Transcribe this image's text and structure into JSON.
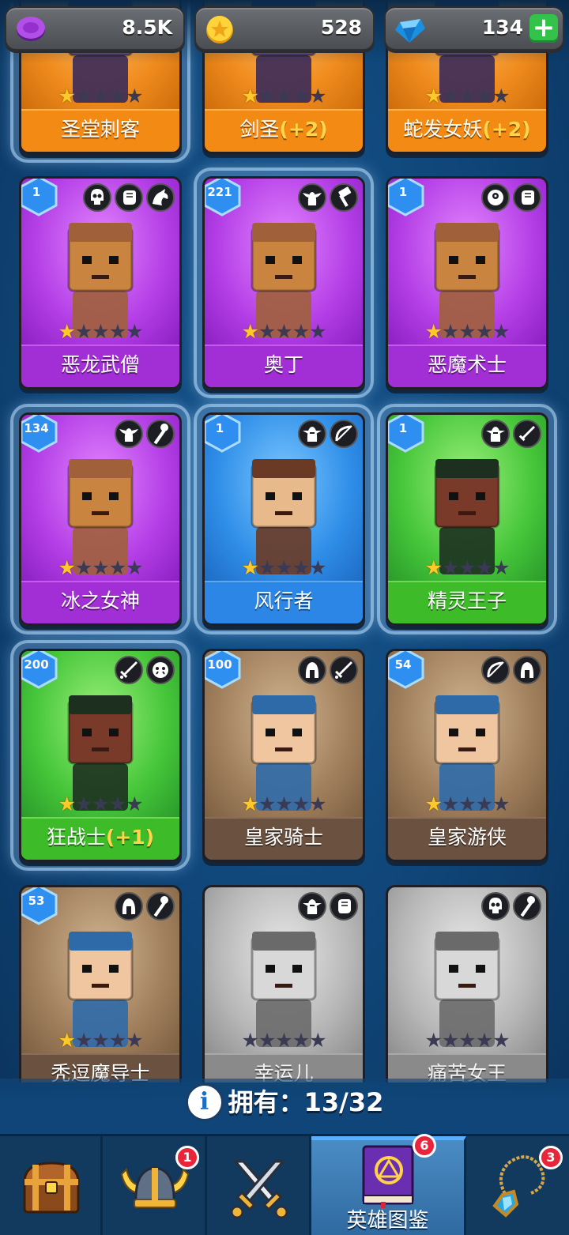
{
  "currency": {
    "gems_purple": "8.5K",
    "coins": "528",
    "diamonds": "134",
    "add_label": "+"
  },
  "cards": [
    {
      "name": "圣堂刺客",
      "bonus": "",
      "stars": 1,
      "max_stars": 5,
      "level": "",
      "rarity": "orange",
      "roles": [],
      "glow": true
    },
    {
      "name": "剑圣",
      "bonus": "(+2)",
      "stars": 1,
      "max_stars": 5,
      "level": "",
      "rarity": "orange",
      "roles": [],
      "glow": false
    },
    {
      "name": "蛇发女妖",
      "bonus": "(+2)",
      "stars": 1,
      "max_stars": 5,
      "level": "",
      "rarity": "orange",
      "roles": [],
      "glow": false
    },
    {
      "name": "恶龙武僧",
      "bonus": "",
      "stars": 1,
      "max_stars": 5,
      "level": "1",
      "rarity": "purple",
      "roles": [
        "skull-icon",
        "fist-icon",
        "dragon-icon"
      ],
      "glow": false
    },
    {
      "name": "奥丁",
      "bonus": "",
      "stars": 1,
      "max_stars": 5,
      "level": "221",
      "rarity": "purple",
      "roles": [
        "winged-helm-icon",
        "hammer-icon"
      ],
      "glow": true
    },
    {
      "name": "恶魔术士",
      "bonus": "",
      "stars": 1,
      "max_stars": 5,
      "level": "1",
      "rarity": "purple",
      "roles": [
        "cyclops-icon",
        "fist-icon"
      ],
      "glow": false
    },
    {
      "name": "冰之女神",
      "bonus": "",
      "stars": 1,
      "max_stars": 5,
      "level": "134",
      "rarity": "purple",
      "roles": [
        "winged-helm-icon",
        "staff-icon"
      ],
      "glow": true
    },
    {
      "name": "风行者",
      "bonus": "",
      "stars": 1,
      "max_stars": 5,
      "level": "1",
      "rarity": "blue",
      "roles": [
        "elf-icon",
        "bow-icon"
      ],
      "glow": true
    },
    {
      "name": "精灵王子",
      "bonus": "",
      "stars": 1,
      "max_stars": 5,
      "level": "1",
      "rarity": "green",
      "roles": [
        "elf-icon",
        "dagger-icon"
      ],
      "glow": true
    },
    {
      "name": "狂战士",
      "bonus": "(+1)",
      "stars": 1,
      "max_stars": 5,
      "level": "200",
      "rarity": "green",
      "roles": [
        "sword-icon",
        "orc-icon"
      ],
      "glow": true
    },
    {
      "name": "皇家骑士",
      "bonus": "",
      "stars": 1,
      "max_stars": 5,
      "level": "100",
      "rarity": "brown",
      "roles": [
        "helmet-icon",
        "sword-icon"
      ],
      "glow": false
    },
    {
      "name": "皇家游侠",
      "bonus": "",
      "stars": 1,
      "max_stars": 5,
      "level": "54",
      "rarity": "brown",
      "roles": [
        "bow-icon",
        "helmet-icon"
      ],
      "glow": false
    },
    {
      "name": "秃逗魔导士",
      "bonus": "",
      "stars": 1,
      "max_stars": 5,
      "level": "53",
      "rarity": "brown",
      "roles": [
        "helmet-icon",
        "staff-icon"
      ],
      "glow": false
    },
    {
      "name": "幸运儿",
      "bonus": "",
      "stars": 0,
      "max_stars": 5,
      "level": "",
      "rarity": "gray",
      "roles": [
        "elf-icon",
        "fist-icon"
      ],
      "glow": false
    },
    {
      "name": "痛苦女王",
      "bonus": "",
      "stars": 0,
      "max_stars": 5,
      "level": "",
      "rarity": "gray",
      "roles": [
        "skull-icon",
        "staff-icon"
      ],
      "glow": false
    }
  ],
  "owned": {
    "label": "拥有：",
    "count": "13/32"
  },
  "nav": [
    {
      "icon": "treasure-chest-icon",
      "label": "",
      "badge": ""
    },
    {
      "icon": "viking-helmet-icon",
      "label": "",
      "badge": "1"
    },
    {
      "icon": "crossed-swords-icon",
      "label": "",
      "badge": ""
    },
    {
      "icon": "hero-book-icon",
      "label": "英雄图鉴",
      "badge": "6",
      "active": true
    },
    {
      "icon": "amulet-icon",
      "label": "",
      "badge": "3"
    }
  ]
}
